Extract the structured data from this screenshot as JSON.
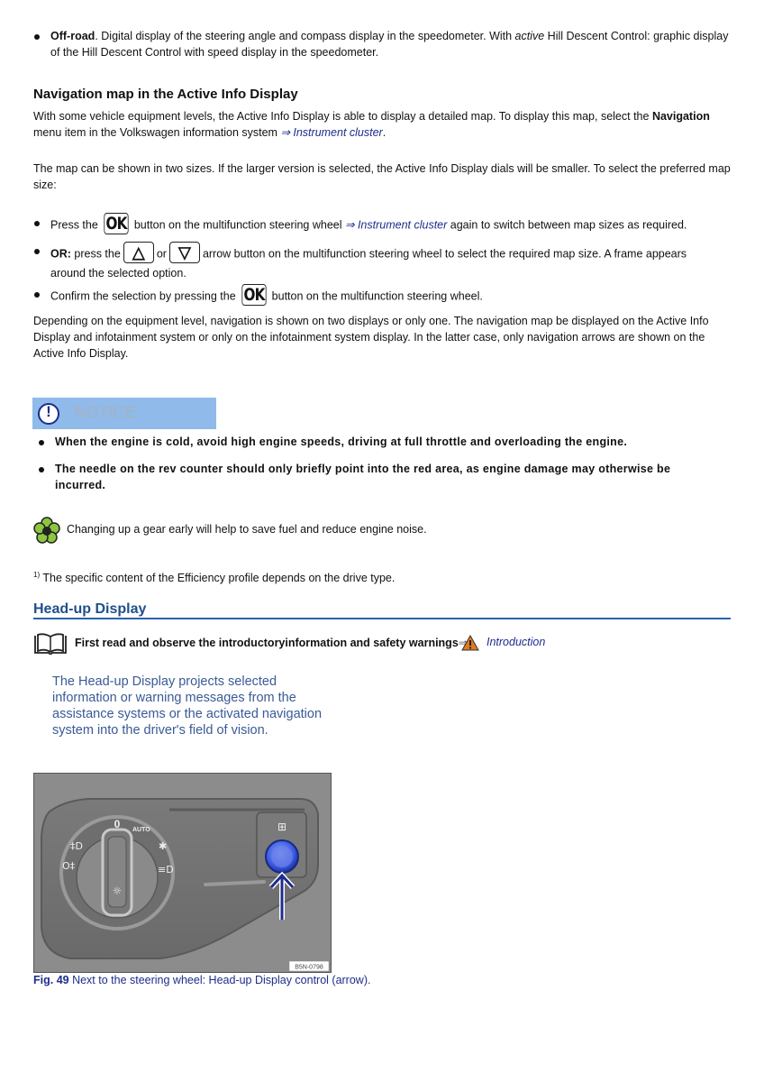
{
  "offroad": {
    "term": "Off-road",
    "text_a": ". Digital display of the steering angle and compass display in the speedometer. With ",
    "italic": "active",
    "text_b": " Hill Descent Control: graphic display",
    "line2": "of the Hill Descent Control with speed display in the speedometer."
  },
  "nav_section": {
    "heading": "Navigation map in the Active Info Display",
    "p1_a": "With some vehicle equipment levels, the Active Info Display is able to display a detailed map. To display this map, select the ",
    "p1_bold": "Navigation",
    "p1_b": "menu item in the Volkswagen information system ",
    "p1_link": "⇒ Instrument cluster",
    "p1_end": ".",
    "p2_line1": "The map can be shown in two sizes. If the larger version is selected, the Active Info Display dials will be smaller. To select the preferred map",
    "p2_line2": "size:",
    "steps": [
      {
        "a": "Press the",
        "key": "OK",
        "b": "button on the multifunction steering wheel ",
        "link": "⇒ Instrument cluster",
        "c": " again to switch between map sizes as required."
      },
      {
        "bold": "OR:",
        "a": " press the",
        "key_up": "△",
        "or": "or",
        "key_down": "▽",
        "b": "arrow button on the multifunction steering wheel to select the required map size. A frame appears",
        "line2": "around the selected option."
      },
      {
        "a": "Confirm the selection by pressing the",
        "key": "OK",
        "b": "button on the multifunction steering wheel."
      }
    ],
    "p3_line1": "Depending on the equipment level, navigation is shown on two displays or only one. The navigation map be displayed on the Active Info",
    "p3_line2": "Display and infotainment system or only on the infotainment system display. In the latter case, only navigation arrows are shown on the",
    "p3_line3": "Active Info Display."
  },
  "notice": {
    "label": "NOTICE",
    "icon": "exclamation-circle-icon",
    "items": [
      "When the engine is cold, avoid high engine speeds, driving at full throttle and overloading the engine.",
      "The needle on the rev counter should only briefly point into the red area, as engine damage may otherwise be"
    ],
    "item2_line2": "incurred."
  },
  "eco_tip": {
    "icon": "eco-flower-icon",
    "text": "Changing up a gear early will help to save fuel and reduce engine noise."
  },
  "footnote": {
    "marker": "1)",
    "text": " The specific content of the Efficiency profile depends on the drive type."
  },
  "hud_section": {
    "title": "Head-up Display",
    "read_first": "First read and observe the introductoryinformation and safety warnings",
    "arrow": "⇒",
    "intro_link": "Introduction",
    "intro_blue": "The Head-up Display projects selected information or warning messages from the assistance systems or the activated navigation system into the driver's field of vision.",
    "figure": {
      "code": "B5N-0798",
      "switch_labels": [
        "0",
        "AUTO"
      ],
      "caption_bold": "Fig. 49",
      "caption": " Next to the steering wheel: Head-up Display control (arrow)."
    }
  },
  "colors": {
    "link": "#1d2c8c",
    "heading_blue": "#1f4e8c",
    "notice_bg": "#8fbaea",
    "eco_green": "#8dc63f"
  }
}
